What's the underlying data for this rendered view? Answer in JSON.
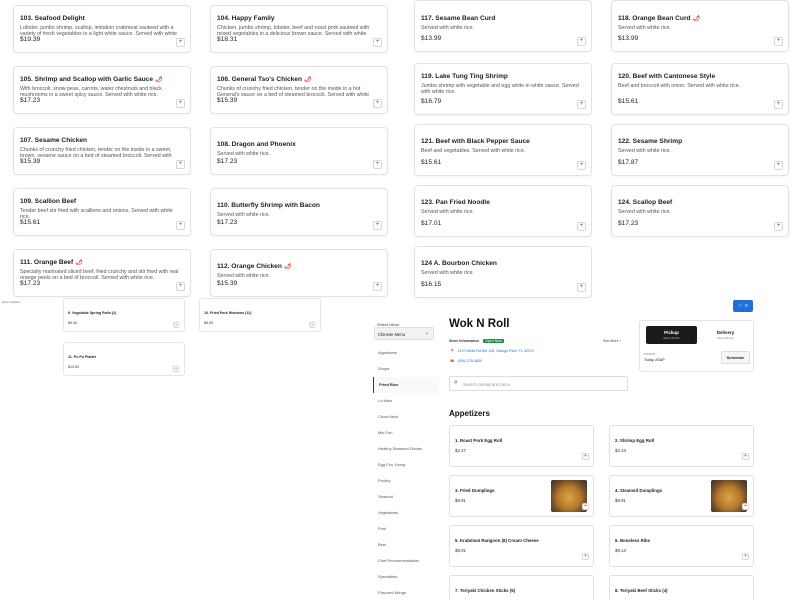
{
  "top_menu": {
    "items": [
      {
        "name": "103. Seafood Delight",
        "hot": false,
        "desc": "Lobster, jumbo shrimp, scallop, imitation crabmeat sauteed with a variety of fresh vegetables in a light white sauce. Served with white rice.",
        "price": "$19.39"
      },
      {
        "name": "104. Happy Family",
        "hot": false,
        "desc": "Chicken, jumbo shrimp, lobster, beef and roast pork sauteed with mixed vegetables in a delicious brown sauce. Served with white rice.",
        "price": "$18.31"
      },
      {
        "name": "117. Sesame Bean Curd",
        "hot": false,
        "desc": "Served with white rice.",
        "price": "$13.99"
      },
      {
        "name": "118. Orange Bean Curd",
        "hot": true,
        "desc": "Served with white rice.",
        "price": "$13.99"
      },
      {
        "name": "105. Shrimp and Scallop with Garlic Sauce",
        "hot": true,
        "desc": "With broccoli, snow peas, carrots, water chestnuts and black mushrooms in a sweet spicy sauce. Served with white rice.",
        "price": "$17.23"
      },
      {
        "name": "106. General Tso's Chicken",
        "hot": true,
        "desc": "Chunks of crunchy fried chicken, tender on the inside in a hot General's sauce on a bed of steamed broccoli. Served with white rice.",
        "price": "$15.39"
      },
      {
        "name": "119. Lake Tung Ting Shrimp",
        "hot": false,
        "desc": "Jumbo shrimp with vegetable and egg white in white sauce. Served with white rice.",
        "price": "$16.79"
      },
      {
        "name": "120. Beef with Cantonese Style",
        "hot": false,
        "desc": "Beef and broccoli with onion. Served with white rice.",
        "price": "$15.61"
      },
      {
        "name": "107. Sesame Chicken",
        "hot": false,
        "desc": "Chunks of crunchy fried chicken, tender on the inside in a sweet, brown, sesame sauce on a bed of steamed broccoli. Served with white rice.",
        "price": "$15.39"
      },
      {
        "name": "108. Dragon and Phoenix",
        "hot": false,
        "desc": "Served with white rice.",
        "price": "$17.23"
      },
      {
        "name": "121. Beef with Black Pepper Sauce",
        "hot": false,
        "desc": "Beef and vegetables. Served with white rice.",
        "price": "$15.61"
      },
      {
        "name": "122. Sesame Shrimp",
        "hot": false,
        "desc": "Served with white rice.",
        "price": "$17.87"
      },
      {
        "name": "109. Scallion Beef",
        "hot": false,
        "desc": "Tender beef stir fried with scallions and onions. Served with white rice.",
        "price": "$15.61"
      },
      {
        "name": "110. Butterfly Shrimp with Bacon",
        "hot": false,
        "desc": "Served with white rice.",
        "price": "$17.23"
      },
      {
        "name": "123. Pan Fried Noodle",
        "hot": false,
        "desc": "Served with white rice.",
        "price": "$17.01"
      },
      {
        "name": "124. Scallop Beef",
        "hot": false,
        "desc": "Served with white rice.",
        "price": "$17.23"
      },
      {
        "name": "111. Orange Beef",
        "hot": true,
        "desc": "Specialty marinated sliced beef, fried crunchy and stir fried with real orange peels on a bed of broccoli. Served with white rice.",
        "price": "$17.23"
      },
      {
        "name": "112. Orange Chicken",
        "hot": true,
        "desc": "Served with white rice.",
        "price": "$15.39"
      },
      {
        "name": "124 A. Bourbon Chicken",
        "hot": false,
        "desc": "Served with white rice.",
        "price": "$16.15"
      }
    ],
    "hot_icon": "🌶",
    "add_icon": "+"
  },
  "small_menu": {
    "label": "spicy classics",
    "items": [
      {
        "name": "9. Vegetable Spring Rolls (2)",
        "price": "$5.35"
      },
      {
        "name": "10. Fried Pork Wontons (12)",
        "price": "$8.05"
      },
      {
        "name": "11. Pu Pu Platter",
        "price": "$14.53"
      }
    ]
  },
  "side_menu": {
    "select_label": "Select Menu",
    "select_value": "Chinese Menu",
    "chevron": "⌄",
    "items": [
      "Appetizers",
      "Soups",
      "Fried Rice",
      "Lo Mein",
      "Chow Mein",
      "Mei Fun",
      "Healthy Steamed Dishes",
      "Egg Foo Young",
      "Poultry",
      "Seafood",
      "Vegetables",
      "Pork",
      "Beef",
      "Chef Recommendation",
      "Specialties",
      "Flavored Wings"
    ],
    "active_index": 2
  },
  "cart": {
    "icon": "🛒",
    "count": "0"
  },
  "restaurant": {
    "name": "Wok N Roll",
    "store_info_label": "Store Information",
    "status": "Open Now",
    "see_more": "See More",
    "see_more_arrow": "›",
    "address": "1670 Wells Rd Ste 108, Orange Park, FL 32073",
    "phone": "(904) 278-4800",
    "pin_icon": "📍",
    "phone_icon": "☎"
  },
  "order": {
    "pickup_label": "Pickup",
    "pickup_sub": "About 20 min",
    "delivery_label": "Delivery",
    "delivery_sub": "About 60 min",
    "pickup_caption": "PICKUP",
    "pickup_time": "Today, ASAP",
    "schedule_label": "Schedule"
  },
  "search": {
    "placeholder": "Search restaurant menu",
    "icon": "⌕"
  },
  "appetizers": {
    "title": "Appetizers",
    "items": [
      {
        "name": "1. Roast Pork Egg Roll",
        "price": "$2.27"
      },
      {
        "name": "2. Shrimp Egg Roll",
        "price": "$2.43"
      },
      {
        "name": "3. Fried Dumplings",
        "price": "$8.91"
      },
      {
        "name": "4. Steamed Dumplings",
        "price": "$8.91"
      },
      {
        "name": "5. Krabmeat Rangoon (8)   Cream Cheese",
        "price": "$8.91"
      },
      {
        "name": "6. Boneless Ribs",
        "price": "$9.13"
      },
      {
        "name": "7. Teriyaki Chicken Sticks (5)",
        "price": ""
      },
      {
        "name": "8. Teriyaki Beef Sticks (4)",
        "price": ""
      }
    ]
  }
}
